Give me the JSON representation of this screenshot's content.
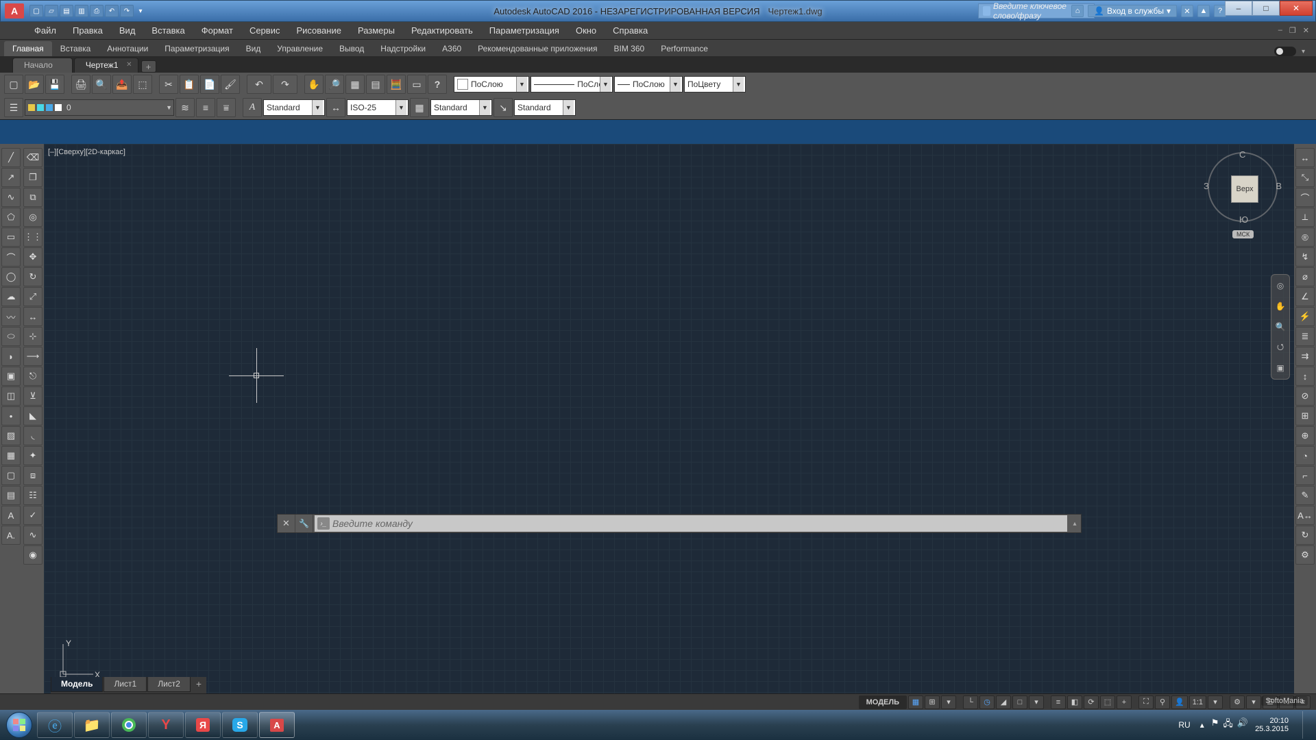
{
  "titlebar": {
    "app_icon_letter": "A",
    "app_name": "Autodesk AutoCAD 2016 - НЕЗАРЕГИСТРИРОВАННАЯ ВЕРСИЯ",
    "file_name": "Чертеж1.dwg",
    "search_placeholder": "Введите ключевое слово/фразу",
    "sign_in": "Вход в службы",
    "help_symbol": "?",
    "min": "–",
    "max": "□",
    "close": "✕"
  },
  "menubar": [
    "Файл",
    "Правка",
    "Вид",
    "Вставка",
    "Формат",
    "Сервис",
    "Рисование",
    "Размеры",
    "Редактировать",
    "Параметризация",
    "Окно",
    "Справка"
  ],
  "ribbon_tabs": [
    "Главная",
    "Вставка",
    "Аннотации",
    "Параметризация",
    "Вид",
    "Управление",
    "Вывод",
    "Надстройки",
    "A360",
    "Рекомендованные приложения",
    "BIM 360",
    "Performance"
  ],
  "ribbon_active_index": 0,
  "filetabs": {
    "inactive": "Начало",
    "active": "Чертеж1",
    "add": "+"
  },
  "toolbar_props": {
    "color": "ПоСлою",
    "linetype": "ПоСлою",
    "lineweight": "ПоСлою",
    "plotstyle": "ПоЦвету"
  },
  "toolbar_styles": {
    "layer": "0",
    "text_style": "Standard",
    "dim_style": "ISO-25",
    "table_style": "Standard",
    "mleader_style": "Standard"
  },
  "canvas": {
    "view_label": "[–][Сверху][2D-каркас]",
    "ucs_y": "Y",
    "ucs_x": "X",
    "vc_top": "Верх",
    "vc_n": "С",
    "vc_s": "Ю",
    "vc_e": "В",
    "vc_w": "З",
    "vc_wcs": "МСК"
  },
  "cmd": {
    "placeholder": "Введите команду"
  },
  "model_tabs": {
    "model": "Модель",
    "l1": "Лист1",
    "l2": "Лист2",
    "add": "+"
  },
  "status": {
    "model": "МОДЕЛЬ",
    "scale": "1:1"
  },
  "tray": {
    "lang": "RU",
    "time": "20:10",
    "date": "25.3.2015"
  },
  "watermark": "SoftoMania"
}
